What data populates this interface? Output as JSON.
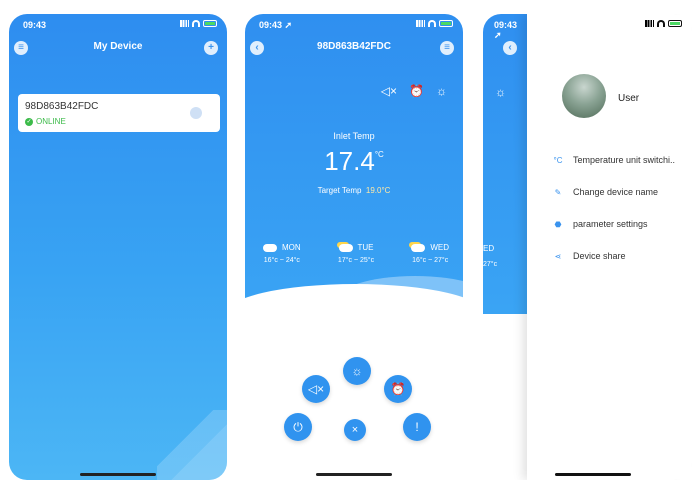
{
  "screen1": {
    "time": "09:43",
    "title": "My Device",
    "menu_icon": "menu-icon",
    "add_icon": "plus-icon",
    "device": {
      "name": "98D863B42FDC",
      "status": "ONLINE"
    }
  },
  "screen2": {
    "time": "09:43 ➚",
    "title": "98D863B42FDC",
    "inlet_label": "Inlet Temp",
    "inlet_value": "17.4",
    "inlet_unit": "°C",
    "target_label": "Target Temp",
    "target_value": "19.0°C",
    "forecast": [
      {
        "day": "MON",
        "range": "16°c ~ 24°c",
        "icon": "cloud-icon"
      },
      {
        "day": "TUE",
        "range": "17°c ~ 25°c",
        "icon": "partly-sunny-icon"
      },
      {
        "day": "WED",
        "range": "16°c ~ 27°c",
        "icon": "partly-sunny-icon"
      }
    ],
    "control_icons": {
      "sun": "☼",
      "mute": "🔇",
      "alarm": "⏰",
      "power": "⏻",
      "close": "×",
      "info": "!"
    }
  },
  "screen3": {
    "time": "09:43 ➚",
    "strip_day": "ED",
    "strip_range": "27°c",
    "user": "User",
    "menu": [
      {
        "label": "Temperature unit switchi..",
        "icon_glyph": "°C"
      },
      {
        "label": "Change device name",
        "icon_glyph": "✎"
      },
      {
        "label": "parameter settings",
        "icon_glyph": "⬣"
      },
      {
        "label": "Device share",
        "icon_glyph": "⋖"
      }
    ]
  },
  "colors": {
    "primary_blue": "#3093ef",
    "online_green": "#3cbb4a",
    "target_yellow": "#ffe9a6"
  }
}
